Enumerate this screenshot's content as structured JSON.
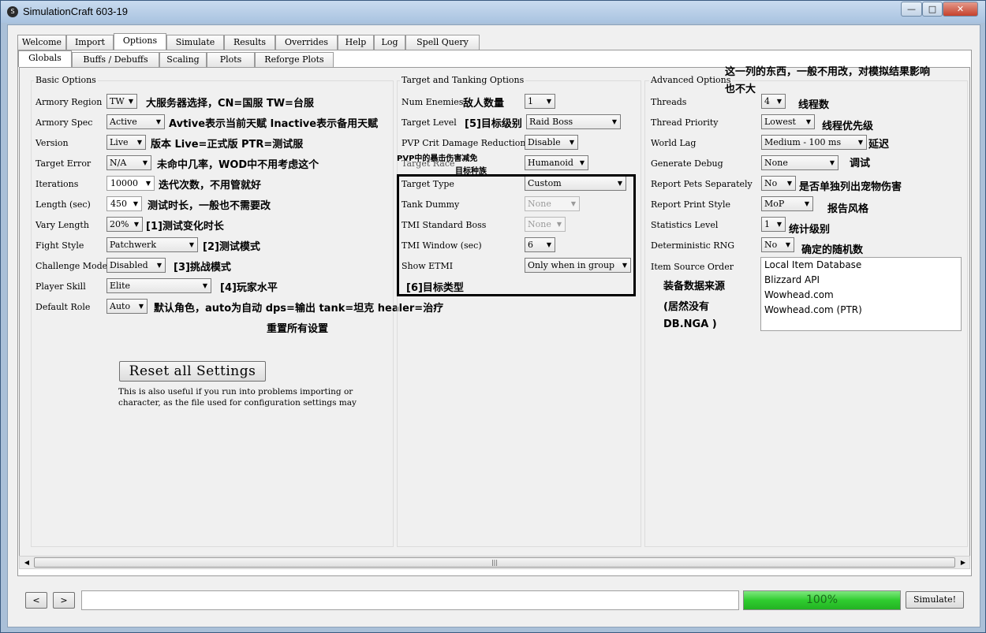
{
  "window": {
    "title": "SimulationCraft 603-19",
    "icon_name": "simc-app-icon",
    "controls": {
      "minimize": "—",
      "maximize": "□",
      "close": "✕"
    }
  },
  "main_tabs": [
    "Welcome",
    "Import",
    "Options",
    "Simulate",
    "Results",
    "Overrides",
    "Help",
    "Log",
    "Spell Query"
  ],
  "main_tabs_active": "Options",
  "sub_tabs": [
    "Globals",
    "Buffs / Debuffs",
    "Scaling",
    "Plots",
    "Reforge Plots"
  ],
  "sub_tabs_active": "Globals",
  "basic": {
    "title": "Basic Options",
    "rows": [
      {
        "label": "Armory Region",
        "value": "TW",
        "note": "大服务器选择，CN=国服 TW=台服"
      },
      {
        "label": "Armory Spec",
        "value": "Active",
        "note": "Avtive表示当前天赋 Inactive表示备用天赋"
      },
      {
        "label": "Version",
        "value": "Live",
        "note": "版本 Live=正式版 PTR=测试服"
      },
      {
        "label": "Target Error",
        "value": "N/A",
        "note": "未命中几率，WOD中不用考虑这个"
      },
      {
        "label": "Iterations",
        "value": "10000",
        "note": "迭代次数，不用管就好"
      },
      {
        "label": "Length (sec)",
        "value": "450",
        "note": "测试时长，一般也不需要改"
      },
      {
        "label": "Vary Length",
        "value": "20%",
        "note": "[1]测试变化时长"
      },
      {
        "label": "Fight Style",
        "value": "Patchwerk",
        "note": "[2]测试模式"
      },
      {
        "label": "Challenge Mode",
        "value": "Disabled",
        "note": "[3]挑战模式"
      },
      {
        "label": "Player Skill",
        "value": "Elite",
        "note": "[4]玩家水平"
      },
      {
        "label": "Default Role",
        "value": "Auto",
        "note": "默认角色，auto为自动 dps=输出 tank=坦克 healer=治疗"
      }
    ],
    "reset_button": "Reset all Settings",
    "reset_note": "重置所有设置",
    "help_line1": "This is also useful if you run into problems importing or",
    "help_line2": "character, as the file used for configuration settings may"
  },
  "target": {
    "title": "Target and Tanking Options",
    "rows": [
      {
        "label": "Num Enemies",
        "value": "1",
        "note": "敌人数量"
      },
      {
        "label": "Target Level",
        "value": "Raid Boss",
        "note": "[5]目标级别"
      },
      {
        "label": "PVP Crit Damage Reduction",
        "value": "Disable",
        "note": "PVP中的暴击伤害减免"
      },
      {
        "label": "Target Race",
        "value": "Humanoid",
        "note": "目标种族"
      },
      {
        "label": "Target Type",
        "value": "Custom"
      },
      {
        "label": "Tank Dummy",
        "value": "None"
      },
      {
        "label": "TMI Standard Boss",
        "value": "None"
      },
      {
        "label": "TMI Window (sec)",
        "value": "6"
      },
      {
        "label": "Show ETMI",
        "value": "Only when in group"
      }
    ],
    "box_note": "[6]目标类型"
  },
  "advanced": {
    "title": "Advanced Options",
    "header_note_1": "这一列的东西，一般不用改，对模拟结果影响",
    "header_note_2": "也不大",
    "rows": [
      {
        "label": "Threads",
        "value": "4",
        "note": "线程数"
      },
      {
        "label": "Thread Priority",
        "value": "Lowest",
        "note": "线程优先级"
      },
      {
        "label": "World Lag",
        "value": "Medium - 100 ms",
        "note": "延迟"
      },
      {
        "label": "Generate Debug",
        "value": "None",
        "note": "调试"
      },
      {
        "label": "Report Pets Separately",
        "value": "No",
        "note": "是否单独列出宠物伤害"
      },
      {
        "label": "Report Print Style",
        "value": "MoP",
        "note": "报告风格"
      },
      {
        "label": "Statistics Level",
        "value": "1",
        "note": "统计级别"
      },
      {
        "label": "Deterministic RNG",
        "value": "No",
        "note": "确定的随机数"
      }
    ],
    "item_source_label": "Item Source Order",
    "item_source": [
      "Local Item Database",
      "Blizzard API",
      "Wowhead.com",
      "Wowhead.com (PTR)"
    ],
    "item_source_note_1": "装备数据来源",
    "item_source_note_2": "(居然没有",
    "item_source_note_3": "DB.NGA )"
  },
  "bottom": {
    "back": "<",
    "forward": ">",
    "command": "",
    "progress_text": "100%",
    "progress_value": 1.0,
    "simulate": "Simulate!"
  },
  "colors": {
    "progress": "#2fcc2f",
    "title_bar": "#b8cee6",
    "close": "#c5412c"
  }
}
